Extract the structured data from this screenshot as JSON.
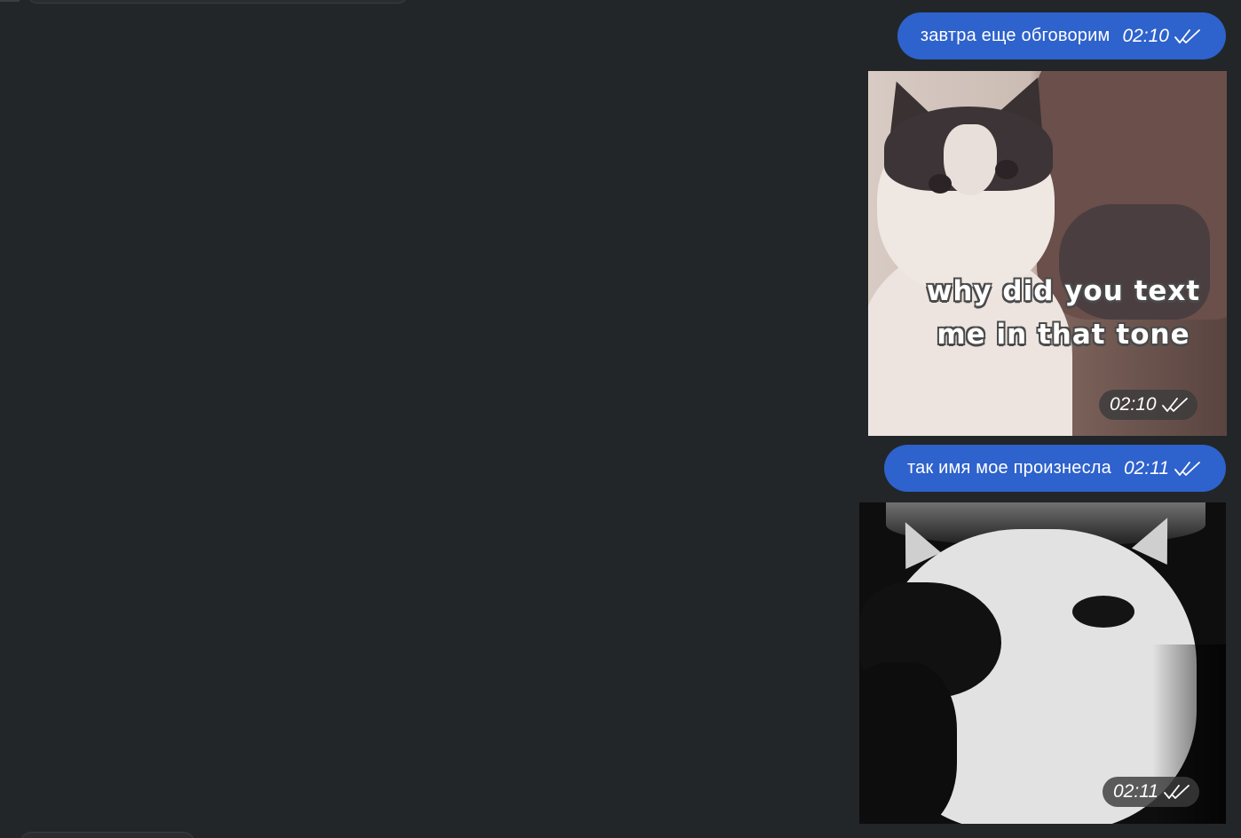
{
  "messages": [
    {
      "type": "text",
      "text": "завтра еще обговорим",
      "time": "02:10",
      "status": "read"
    },
    {
      "type": "gif",
      "caption_in_image": [
        "why did you text",
        "me in that tone"
      ],
      "time": "02:10",
      "status": "read"
    },
    {
      "type": "text",
      "text": "так имя мое произнесла",
      "time": "02:11",
      "status": "read"
    },
    {
      "type": "gif",
      "time": "02:11",
      "status": "read"
    }
  ],
  "icons": {
    "read_status": "double-check-icon"
  },
  "colors": {
    "background": "#232628",
    "outgoing_bubble": "#2e62cc",
    "text": "#ffffff"
  }
}
